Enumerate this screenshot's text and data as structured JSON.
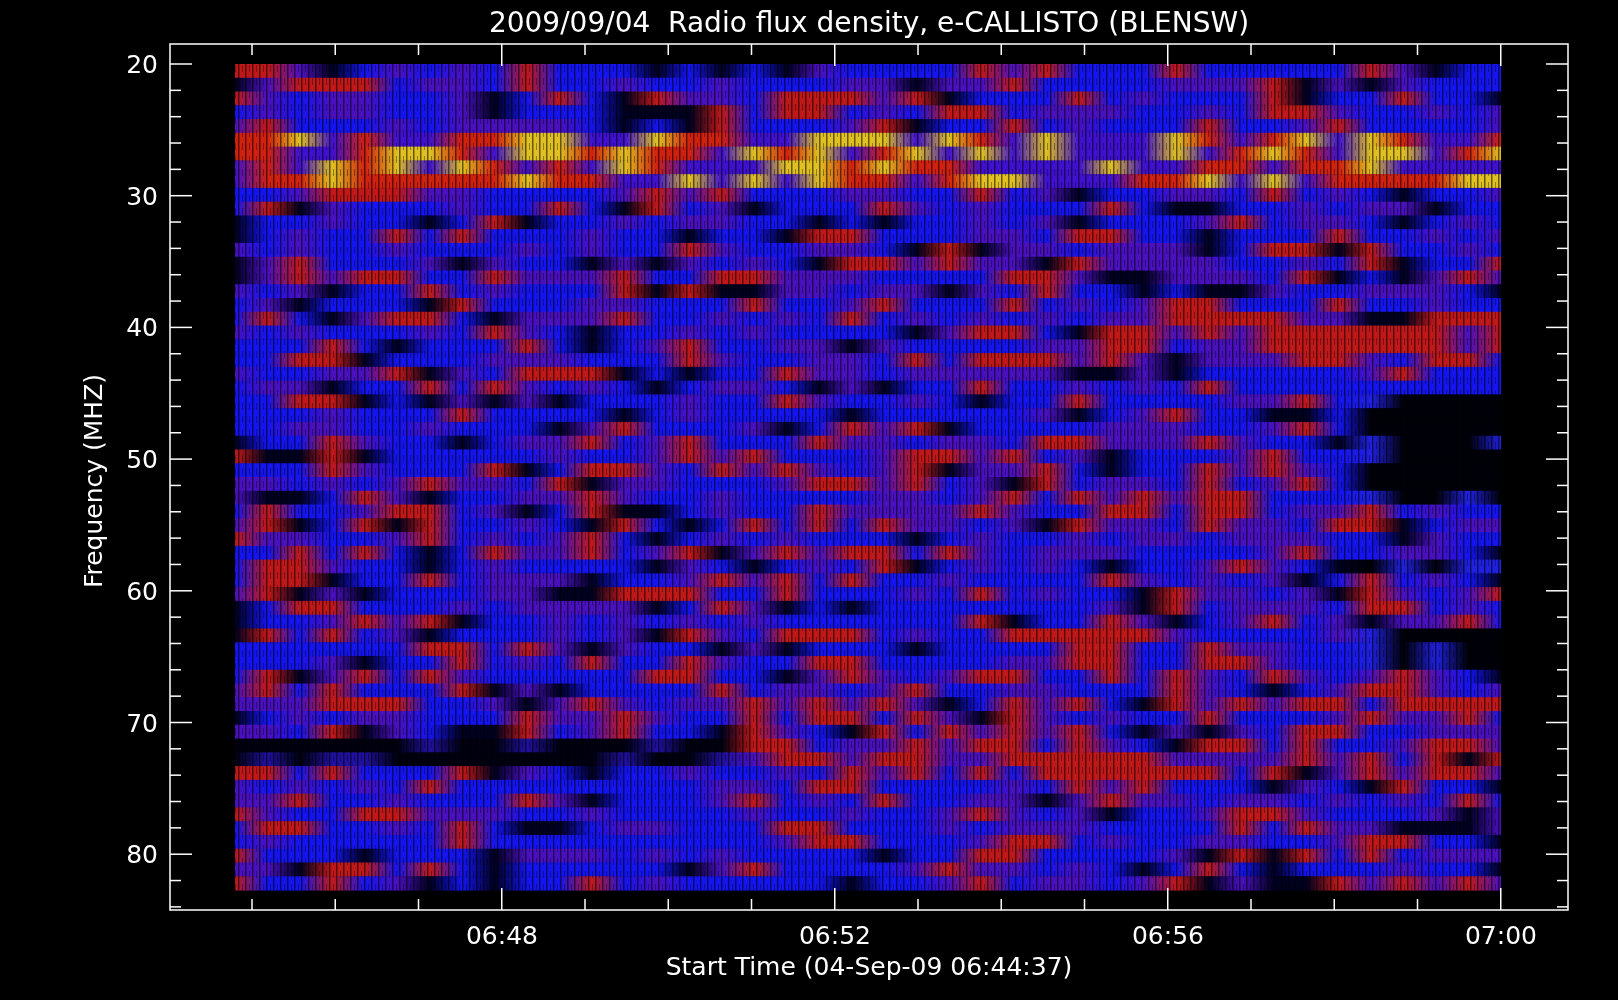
{
  "title": "2009/09/04  Radio flux density, e-CALLISTO (BLENSW)",
  "y_axis": {
    "label": "Frequency (MHZ)",
    "ticks": [
      "20",
      "30",
      "40",
      "50",
      "60",
      "70",
      "80"
    ]
  },
  "x_axis": {
    "label": "Start Time (04-Sep-09 06:44:37)",
    "ticks": [
      "06:48",
      "06:52",
      "06:56",
      "07:00"
    ]
  }
}
